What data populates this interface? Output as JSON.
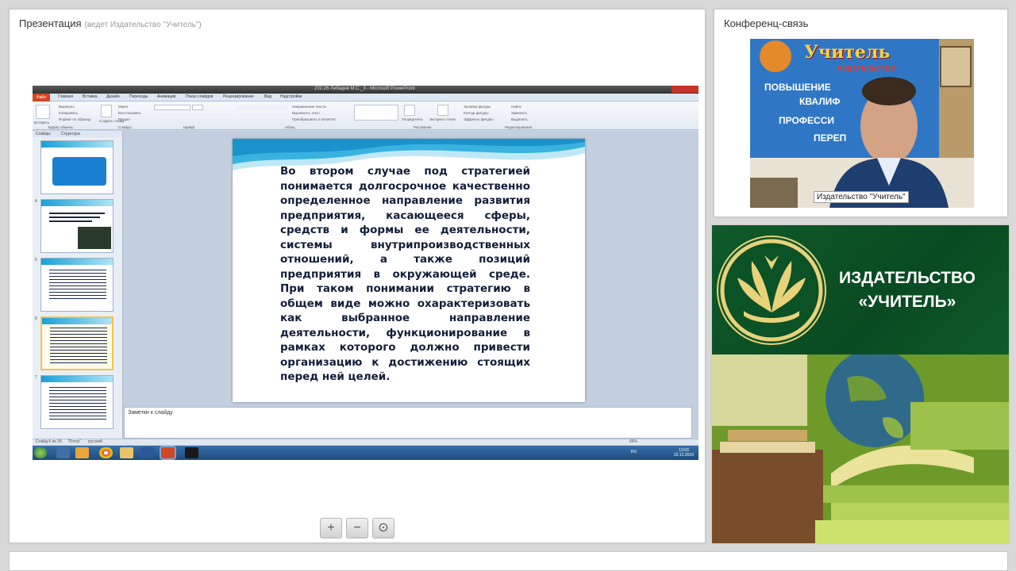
{
  "presentation": {
    "title": "Презентация",
    "host": "(ведет Издательство \"Учитель\")"
  },
  "powerpoint": {
    "window_title": "202.26 Лебедев М.С._3 - Microsoft PowerPoint",
    "file_tab": "Файл",
    "tabs": [
      "Главная",
      "Вставка",
      "Дизайн",
      "Переходы",
      "Анимация",
      "Показ слайдов",
      "Рецензирование",
      "Вид",
      "Надстройки"
    ],
    "ribbon": {
      "paste": "Вставить",
      "cut": "Вырезать",
      "copy": "Копировать",
      "format_painter": "Формат по образцу",
      "clipboard": "Буфер обмена",
      "new_slide": "Создать слайд",
      "layout": "Макет",
      "reset": "Восстановить",
      "section": "Раздел",
      "slides_group": "Слайды",
      "font_group": "Шрифт",
      "paragraph_group": "Абзац",
      "text_direction": "Направление текста",
      "align_text": "Выровнять текст",
      "convert_smartart": "Преобразовать в SmartArt",
      "arrange": "Упорядочить",
      "quick_styles": "Экспресс-стили",
      "drawing_group": "Рисование",
      "shape_fill": "Заливка фигуры",
      "shape_outline": "Контур фигуры",
      "shape_effects": "Эффекты фигуры",
      "find": "Найти",
      "replace": "Заменить",
      "select": "Выделить",
      "editing_group": "Редактирование"
    },
    "panel_tabs": [
      "Слайды",
      "Структура"
    ],
    "thumb_numbers": [
      "",
      "4",
      "5",
      "6",
      "7"
    ],
    "slide_text": "Во втором случае под стратегией понимается долгосрочное качественно определенное направление развития предприятия, касающееся сферы, средств и формы ее деятельности, системы внутрипроизводственных отношений, а также позиций предприятия в окружающей среде. При таком понимании стратегию в общем виде можно охарактеризовать как выбранное направление деятельности, функционирование в рамках которого должно привести организацию к достижению стоящих перед ней целей.",
    "notes_placeholder": "Заметки к слайду",
    "status": {
      "slide": "Слайд 6 из 26",
      "theme": "\"Поток\"",
      "language": "русский",
      "zoom": "66%"
    },
    "clock": {
      "time": "13:03",
      "date": "22.12.2016",
      "lang": "RU"
    }
  },
  "zoom": {
    "in": "+",
    "out": "−",
    "fit": "⊙"
  },
  "conference": {
    "title": "Конференц-связь",
    "speaker_label": "Издательство \"Учитель\"",
    "background_sign": {
      "brand": "Учитель",
      "sub": "ИЗДАТЕЛЬСТВО",
      "lines": [
        "ПОВЫШЕНИЕ",
        "КВАЛИФ",
        "ПРОФЕССИ",
        "ПЕРЕП"
      ]
    }
  },
  "banner": {
    "line1": "ИЗДАТЕЛЬСТВО",
    "line2": "«УЧИТЕЛЬ»",
    "colors": {
      "green": "#0b5226",
      "gold": "#e8d27a"
    }
  }
}
